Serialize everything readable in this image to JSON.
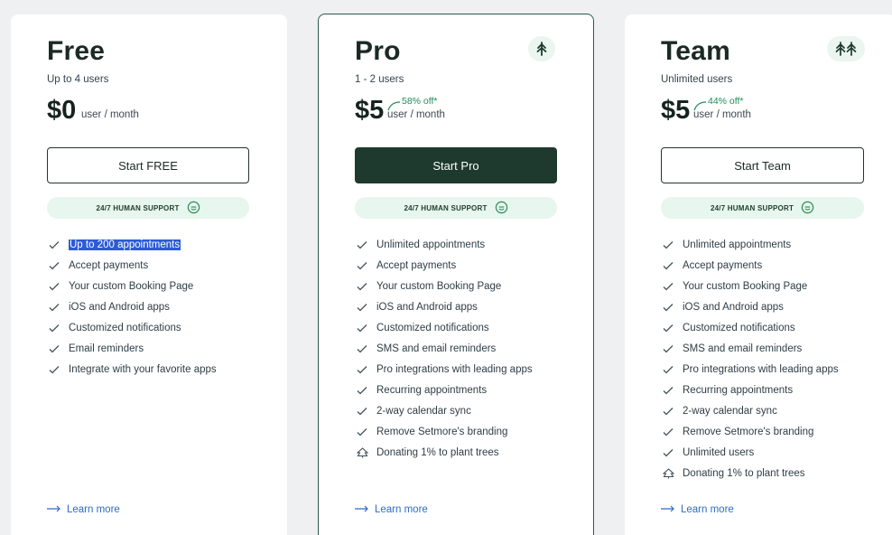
{
  "plans": {
    "free": {
      "name": "Free",
      "users": "Up to 4 users",
      "price": "$0",
      "unit": "user / month",
      "cta": "Start FREE",
      "support": "24/7 HUMAN SUPPORT",
      "features": [
        "Up to 200 appointments",
        "Accept payments",
        "Your custom Booking Page",
        "iOS and Android apps",
        "Customized notifications",
        "Email reminders",
        "Integrate with your favorite apps"
      ],
      "learn_more": "Learn more"
    },
    "pro": {
      "name": "Pro",
      "users": "1 - 2 users",
      "price": "$5",
      "discount": "58% off*",
      "unit": "user / month",
      "cta": "Start Pro",
      "support": "24/7 HUMAN SUPPORT",
      "features": [
        "Unlimited appointments",
        "Accept payments",
        "Your custom Booking Page",
        "iOS and Android apps",
        "Customized notifications",
        "SMS and email reminders",
        "Pro integrations with leading apps",
        "Recurring appointments",
        "2-way calendar sync",
        "Remove Setmore's branding",
        "Donating 1% to plant trees"
      ],
      "learn_more": "Learn more"
    },
    "team": {
      "name": "Team",
      "users": "Unlimited users",
      "price": "$5",
      "discount": "44% off*",
      "unit": "user / month",
      "cta": "Start Team",
      "support": "24/7 HUMAN SUPPORT",
      "features": [
        "Unlimited appointments",
        "Accept payments",
        "Your custom Booking Page",
        "iOS and Android apps",
        "Customized notifications",
        "SMS and email reminders",
        "Pro integrations with leading apps",
        "Recurring appointments",
        "2-way calendar sync",
        "Remove Setmore's branding",
        "Unlimited users",
        "Donating 1% to plant trees"
      ],
      "learn_more": "Learn more"
    }
  },
  "icons": {
    "feature": "checkmark-icon",
    "tree_feature": "tree-outline-icon",
    "pro_badge": "single-tree-icon",
    "team_badge": "two-trees-icon",
    "support": "smiley-chat-icon",
    "learn": "arrow-right-icon"
  },
  "colors": {
    "accent_dark": "#1e3a2f",
    "discount": "#1e8e5a",
    "support_bg": "#e7f6ee",
    "link": "#2d6cc8",
    "selection": "#2d5bd7"
  }
}
